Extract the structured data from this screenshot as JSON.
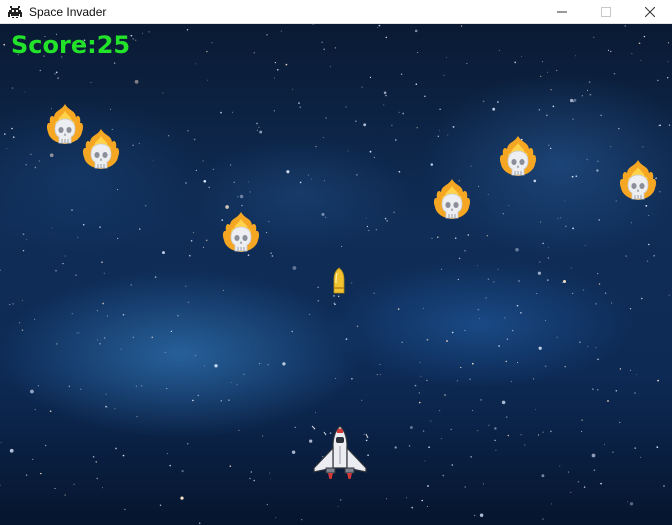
{
  "window": {
    "title": "Space Invader",
    "minimize_icon": "minimize-icon",
    "maximize_icon": "maximize-icon",
    "close_icon": "close-icon"
  },
  "hud": {
    "score_text": "Score:25"
  },
  "colors": {
    "score": "#22e22a",
    "space_dark": "#0a1a33",
    "space_blue": "#0f2d57",
    "flame": "#f5a623",
    "skull": "#e9e9ee"
  },
  "sprites": {
    "enemy_icon": "flaming-skull-icon",
    "player_icon": "space-shuttle-icon",
    "bullet_icon": "bullet-icon"
  }
}
